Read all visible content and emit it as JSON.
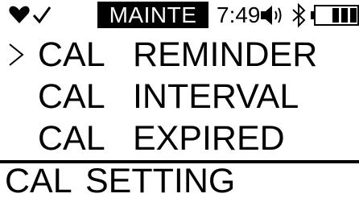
{
  "status_bar": {
    "mode": "MAINTE",
    "time": "7:49",
    "icons": [
      "heart-icon",
      "check-icon",
      "speaker-icon",
      "bluetooth-icon",
      "battery-icon"
    ]
  },
  "menu": {
    "items": [
      {
        "label": "CAL  REMINDER",
        "selected": true
      },
      {
        "label": "CAL  INTERVAL",
        "selected": false
      },
      {
        "label": "CAL  EXPIRED",
        "selected": false
      }
    ]
  },
  "footer": {
    "title": "CAL  SETTING"
  }
}
